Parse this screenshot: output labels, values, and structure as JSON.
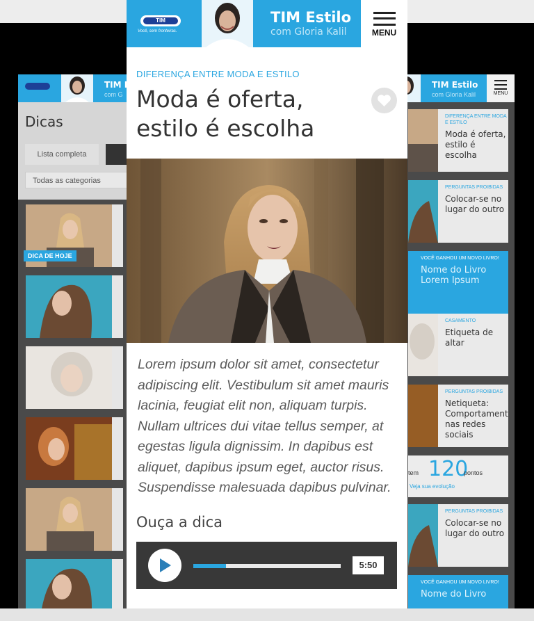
{
  "left_screen": {
    "brand_title": "TIM E",
    "brand_sub": "com G",
    "dicas_title": "Dicas",
    "lista_label": "Lista completa",
    "category_select": "Todas as categorias",
    "today_badge": "DICA DE HOJE"
  },
  "right_screen": {
    "brand_title": "TIM Estilo",
    "brand_sub": "com Gloria Kalil",
    "menu_label": "MENU",
    "cards": [
      {
        "category": "DIFERENÇA ENTRE MODA E ESTILO",
        "title": "Moda é oferta, estilo é escolha"
      },
      {
        "category": "PERGUNTAS PROIBIDAS",
        "title": "Colocar-se no lugar do outro"
      },
      {
        "category": "VOCÊ GANHOU UM NOVO LIVRO!",
        "title": "Nome do Livro Lorem Ipsum"
      },
      {
        "category": "CASAMENTO",
        "title": "Etiqueta de altar"
      },
      {
        "category": "PERGUNTAS PROIBIDAS",
        "title": "Netiqueta: Comportamento nas redes sociais"
      },
      {
        "category": "PERGUNTAS PROIBIDAS",
        "title": "Colocar-se no lugar do outro"
      },
      {
        "category": "VOCÊ GANHOU UM NOVO LIVRO!",
        "title": "Nome do Livro"
      }
    ],
    "points": {
      "prefix": "tem",
      "value": "120",
      "unit": "pontos",
      "link": "Veja sua evolução"
    }
  },
  "header": {
    "logo_text": "TIM",
    "logo_tagline": "Você, sem fronteiras.",
    "title": "TIM Estilo",
    "subtitle": "com Gloria Kalil",
    "menu_label": "MENU"
  },
  "article": {
    "category": "DIFERENÇA ENTRE MODA E ESTILO",
    "title": "Moda é oferta, estilo é escolha",
    "body": "Lorem ipsum dolor sit amet, consectetur adipiscing elit. Vestibulum sit amet mauris lacinia, feugiat elit non, aliquam turpis. Nullam ultrices dui vitae tellus semper, at egestas ligula dignissim. In dapibus est aliquet, dapibus ipsum eget, auctor risus. Suspendisse malesuada dapibus pulvinar."
  },
  "audio": {
    "heading": "Ouça a dica",
    "duration": "5:50",
    "progress": 0.22
  },
  "colors": {
    "accent": "#2aa6e0",
    "brand_blue": "#1d3f97",
    "player_bg": "#383838"
  },
  "icons": [
    "menu-icon",
    "heart-icon",
    "play-icon"
  ]
}
